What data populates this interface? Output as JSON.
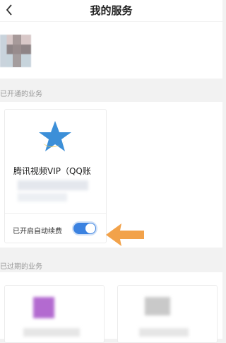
{
  "header": {
    "title": "我的服务",
    "back_icon": "chevron-left-icon"
  },
  "sections": {
    "active_label": "已开通的业务",
    "expired_label": "已过期的业务"
  },
  "active_service": {
    "name": "腾讯视频VIP（QQ账",
    "icon": "tencent-video-star-icon",
    "auto_renew_label": "已开启自动续费",
    "auto_renew_on": true
  },
  "colors": {
    "toggle_on": "#3b82e0",
    "arrow": "#f2a24a",
    "logo_star": "#3c8fd8",
    "logo_moon": "#f4c542"
  }
}
